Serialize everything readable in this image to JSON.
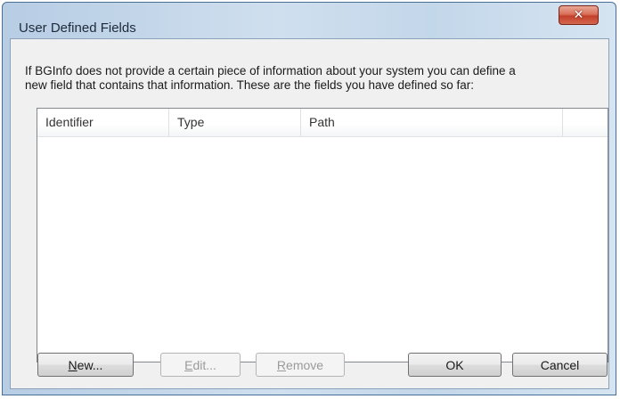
{
  "window": {
    "title": "User Defined Fields"
  },
  "titlebar": {
    "close_icon": "close-icon",
    "close_glyph": "✕"
  },
  "dialog": {
    "description_line1": "If BGInfo does not provide a certain piece of information about your system you can define a",
    "description_line2": "new field that contains that information. These are the fields you have defined so far:"
  },
  "fields_list": {
    "columns": [
      "Identifier",
      "Type",
      "Path",
      ""
    ],
    "rows": []
  },
  "buttons": {
    "new": {
      "accel": "N",
      "rest": "ew..."
    },
    "edit": {
      "accel": "E",
      "rest": "dit..."
    },
    "remove": {
      "accel": "R",
      "rest": "emove"
    },
    "ok": "OK",
    "cancel": "Cancel"
  },
  "colors": {
    "close_button": "#c2402a",
    "client_background": "#f0f0f0",
    "disabled_text": "#9a9a9a"
  }
}
